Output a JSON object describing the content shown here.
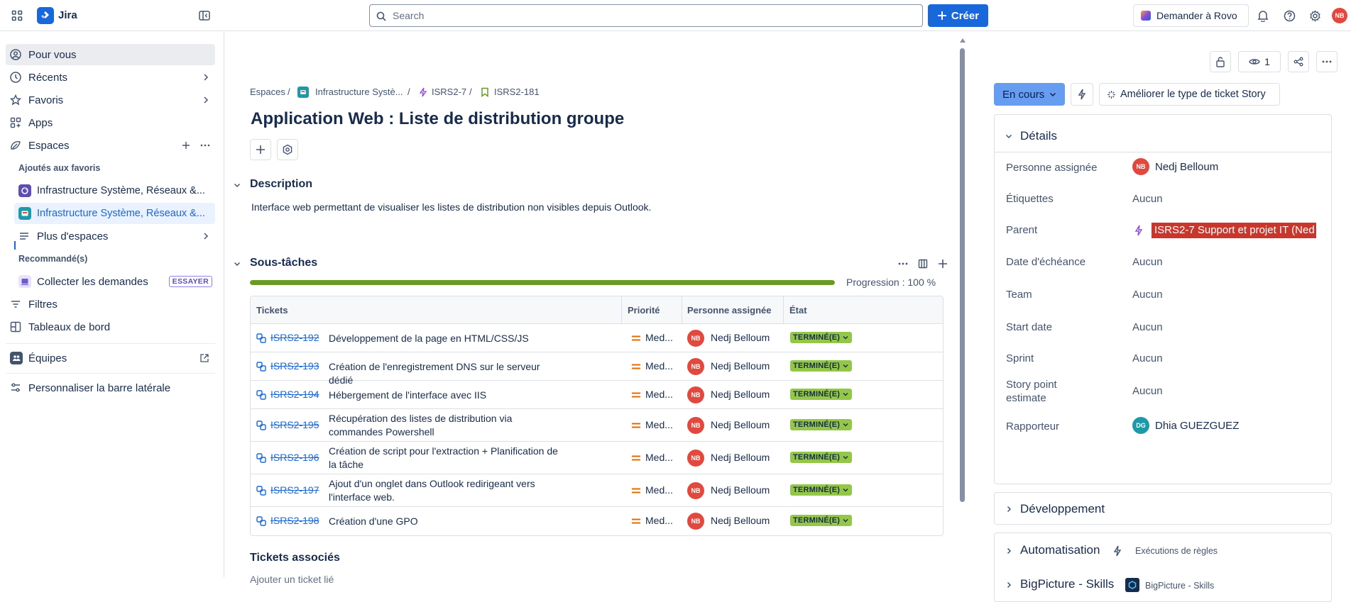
{
  "topbar": {
    "app_name": "Jira",
    "search_placeholder": "Search",
    "create_label": "Créer",
    "rovo_label": "Demander à Rovo",
    "user_initials": "NB"
  },
  "sidebar": {
    "for_you": "Pour vous",
    "recent": "Récents",
    "favorites": "Favoris",
    "apps": "Apps",
    "spaces": "Espaces",
    "favorites_header": "Ajoutés aux favoris",
    "fav1": "Infrastructure Système, Réseaux &...",
    "fav2": "Infrastructure Système, Réseaux &...",
    "more_spaces": "Plus d'espaces",
    "recommended_header": "Recommandé(s)",
    "collect": "Collecter les demandes",
    "try_badge": "ESSAYER",
    "filters": "Filtres",
    "dashboards": "Tableaux de bord",
    "teams": "Équipes",
    "customize": "Personnaliser la barre latérale"
  },
  "breadcrumb": {
    "spaces": "Espaces",
    "project": "Infrastructure Systè...",
    "parent": "ISRS2-7",
    "current": "ISRS2-181"
  },
  "issue": {
    "title": "Application Web : Liste de distribution groupe",
    "description_heading": "Description",
    "description": "Interface web permettant de visualiser les listes de distribution non visibles depuis Outlook.",
    "subtasks_heading": "Sous-tâches",
    "progress_label": "Progression : 100 %",
    "progress": 1.0,
    "linked_heading": "Tickets associés",
    "linked_add": "Ajouter un ticket lié"
  },
  "subtasks": {
    "headers": [
      "Tickets",
      "Priorité",
      "Personne assignée",
      "État"
    ],
    "rows": [
      {
        "key": "ISRS2-192",
        "summary": "Développement de la page en HTML/CSS/JS",
        "priority": "Med...",
        "assignee": "Nedj Belloum",
        "initials": "NB",
        "status": "TERMINÉ(E)"
      },
      {
        "key": "ISRS2-193",
        "summary": "Création de l'enregistrement DNS sur le serveur dédié",
        "priority": "Med...",
        "assignee": "Nedj Belloum",
        "initials": "NB",
        "status": "TERMINÉ(E)"
      },
      {
        "key": "ISRS2-194",
        "summary": "Hébergement de l'interface avec IIS",
        "priority": "Med...",
        "assignee": "Nedj Belloum",
        "initials": "NB",
        "status": "TERMINÉ(E)"
      },
      {
        "key": "ISRS2-195",
        "summary": "Récupération des listes de distribution via commandes Powershell",
        "priority": "Med...",
        "assignee": "Nedj Belloum",
        "initials": "NB",
        "status": "TERMINÉ(E)"
      },
      {
        "key": "ISRS2-196",
        "summary": "Création de script pour l'extraction + Planification de la tâche",
        "priority": "Med...",
        "assignee": "Nedj Belloum",
        "initials": "NB",
        "status": "TERMINÉ(E)"
      },
      {
        "key": "ISRS2-197",
        "summary": "Ajout d'un onglet dans Outlook redirigeant vers l'interface web.",
        "priority": "Med...",
        "assignee": "Nedj Belloum",
        "initials": "NB",
        "status": "TERMINÉ(E)"
      },
      {
        "key": "ISRS2-198",
        "summary": "Création d'une GPO",
        "priority": "Med...",
        "assignee": "Nedj Belloum",
        "initials": "NB",
        "status": "TERMINÉ(E)"
      }
    ]
  },
  "right": {
    "watchers": "1",
    "status_button": "En cours",
    "improve_label": "Améliorer le type de ticket Story",
    "details_heading": "Détails",
    "fields": {
      "assignee_label": "Personne assignée",
      "assignee": "Nedj Belloum",
      "assignee_initials": "NB",
      "labels_label": "Étiquettes",
      "labels": "Aucun",
      "parent_label": "Parent",
      "parent": "ISRS2-7 Support et projet IT (Ned",
      "due_label": "Date d'échéance",
      "due": "Aucun",
      "team_label": "Team",
      "team": "Aucun",
      "start_label": "Start date",
      "start": "Aucun",
      "sprint_label": "Sprint",
      "sprint": "Aucun",
      "sp_label": "Story point estimate",
      "sp": "Aucun",
      "reporter_label": "Rapporteur",
      "reporter": "Dhia GUEZGUEZ",
      "reporter_initials": "DG"
    },
    "dev_heading": "Développement",
    "auto_heading": "Automatisation",
    "auto_sub": "Exécutions de règles",
    "bp_heading": "BigPicture - Skills",
    "bp_sub": "BigPicture - Skills"
  },
  "colors": {
    "accent": "#1868db",
    "status_done": "#94c748",
    "avatar_nb": "#e2483d",
    "avatar_dg": "#1d9aaa",
    "progress": "#6a9a23",
    "parent_highlight": "#c9372c"
  }
}
